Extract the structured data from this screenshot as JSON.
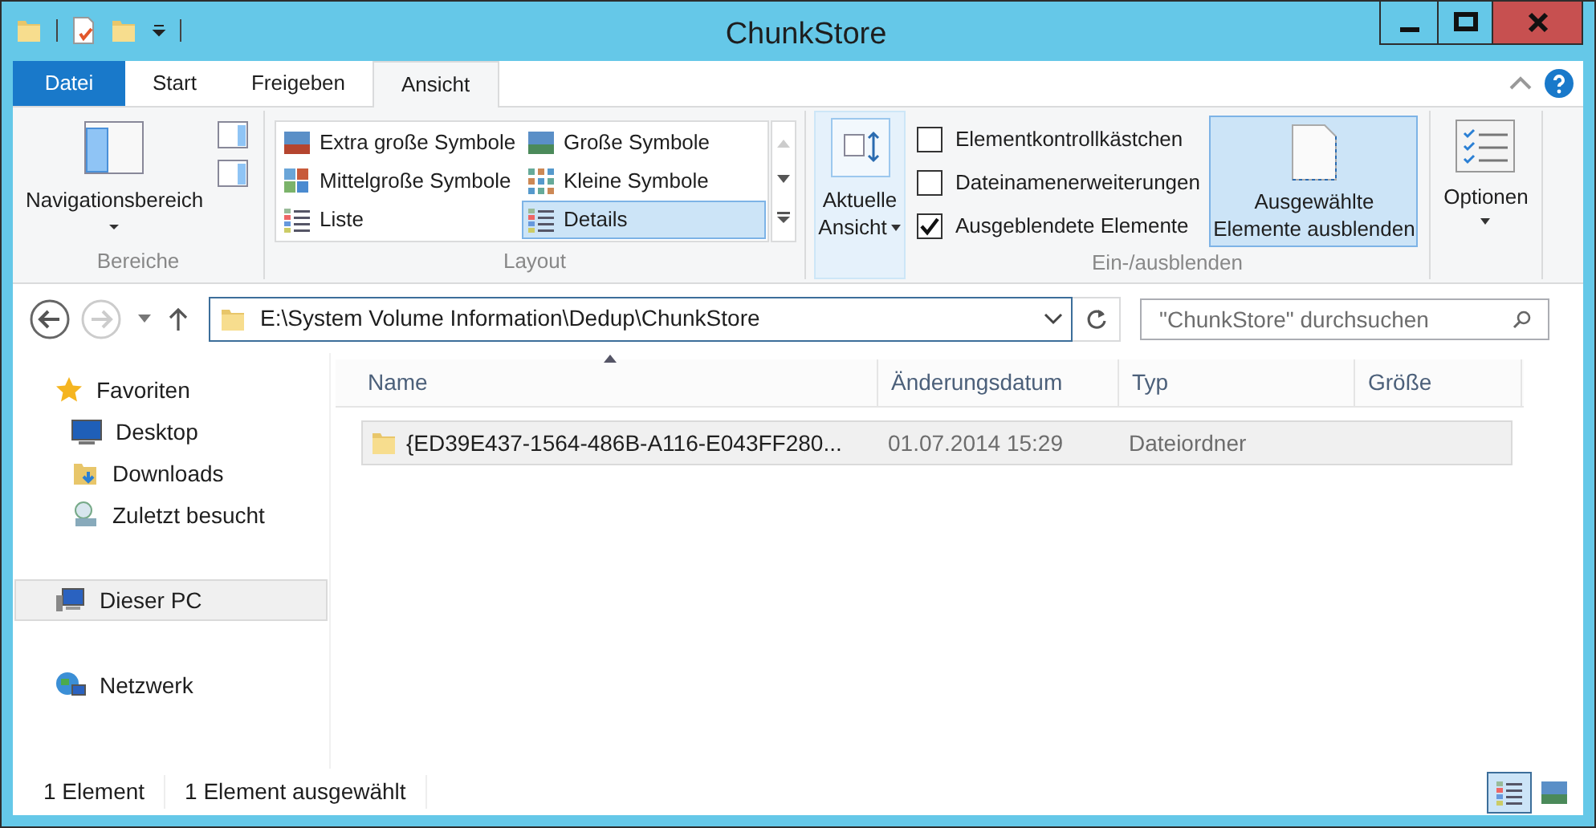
{
  "window": {
    "title": "ChunkStore"
  },
  "ribbon_tabs": [
    {
      "label": "Datei",
      "kind": "file",
      "selected": false
    },
    {
      "label": "Start",
      "kind": "tab",
      "selected": false
    },
    {
      "label": "Freigeben",
      "kind": "tab",
      "selected": false
    },
    {
      "label": "Ansicht",
      "kind": "tab",
      "selected": true
    }
  ],
  "ribbon": {
    "panes": {
      "button": "Navigationsbereich",
      "group": "Bereiche"
    },
    "layout": {
      "group": "Layout",
      "items": [
        {
          "label": "Extra große Symbole",
          "selected": false
        },
        {
          "label": "Große Symbole",
          "selected": false
        },
        {
          "label": "Mittelgroße Symbole",
          "selected": false
        },
        {
          "label": "Kleine Symbole",
          "selected": false
        },
        {
          "label": "Liste",
          "selected": false
        },
        {
          "label": "Details",
          "selected": true
        }
      ]
    },
    "current_view": {
      "label_1": "Aktuelle",
      "label_2": "Ansicht"
    },
    "show_hide": {
      "group": "Ein-/ausblenden",
      "checkboxes": [
        {
          "label": "Elementkontrollkästchen",
          "checked": false
        },
        {
          "label": "Dateinamenerweiterungen",
          "checked": false
        },
        {
          "label": "Ausgeblendete Elemente",
          "checked": true
        }
      ],
      "hide_button": {
        "label_1": "Ausgewählte",
        "label_2": "Elemente ausblenden"
      }
    },
    "options": {
      "label": "Optionen"
    }
  },
  "address_bar": {
    "value": "E:\\System Volume Information\\Dedup\\ChunkStore"
  },
  "search": {
    "placeholder": "\"ChunkStore\" durchsuchen"
  },
  "navigation": [
    {
      "label": "Favoriten",
      "kind": "star",
      "selected": false,
      "children": [
        {
          "label": "Desktop",
          "kind": "desktop",
          "selected": false
        },
        {
          "label": "Downloads",
          "kind": "downloads",
          "selected": false
        },
        {
          "label": "Zuletzt besucht",
          "kind": "recent",
          "selected": false
        }
      ]
    },
    {
      "label": "Dieser PC",
      "kind": "pc",
      "selected": true
    },
    {
      "label": "Netzwerk",
      "kind": "network",
      "selected": false
    }
  ],
  "table": {
    "columns": [
      "Name",
      "Änderungsdatum",
      "Typ",
      "Größe"
    ],
    "rows": [
      {
        "name": "{ED39E437-1564-486B-A116-E043FF280...",
        "date": "01.07.2014 15:29",
        "type": "Dateiordner",
        "selected": true
      }
    ]
  },
  "status_bar": {
    "count": "1 Element",
    "selection": "1 Element ausgewählt"
  }
}
